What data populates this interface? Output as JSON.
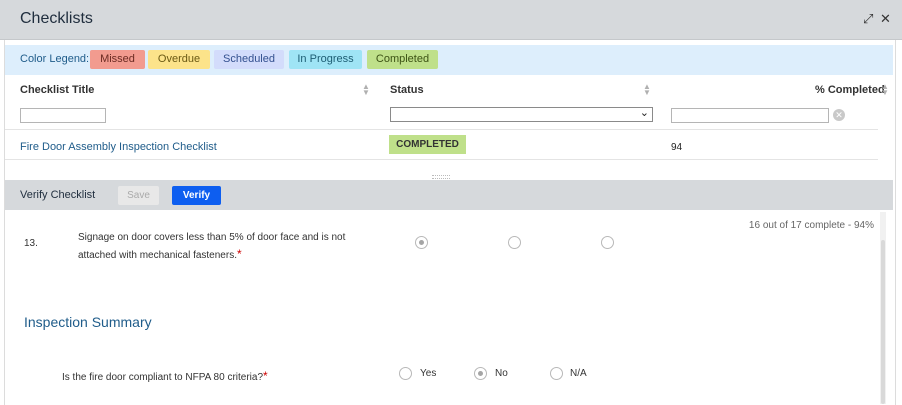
{
  "window": {
    "title": "Checklists",
    "expand_icon": "expand-icon",
    "close_icon": "close-icon"
  },
  "legend": {
    "label": "Color Legend:",
    "items": [
      {
        "label": "Missed",
        "bg": "#f29b8f",
        "fg": "#6b2a22"
      },
      {
        "label": "Overdue",
        "bg": "#fce38a",
        "fg": "#6b5a14"
      },
      {
        "label": "Scheduled",
        "bg": "#d3dcfb",
        "fg": "#33508f"
      },
      {
        "label": "In Progress",
        "bg": "#9fe4f5",
        "fg": "#1d5d73"
      },
      {
        "label": "Completed",
        "bg": "#bfe08a",
        "fg": "#3c5214"
      }
    ]
  },
  "table": {
    "columns": [
      "Checklist Title",
      "Status",
      "% Completed"
    ],
    "rows": [
      {
        "title": "Fire Door Assembly Inspection Checklist",
        "status": "COMPLETED",
        "percent": "94"
      }
    ]
  },
  "verify": {
    "title": "Verify Checklist",
    "save_label": "Save",
    "verify_label": "Verify"
  },
  "checklist": {
    "progress": "16 out of 17 complete - 94%",
    "question": {
      "number": "13.",
      "text": "Signage on door covers less than 5% of door face and is not attached with mechanical fasteners.",
      "required_mark": "*",
      "selected_option": 0
    },
    "summary_title": "Inspection Summary",
    "summary_question": {
      "text": "Is the fire door compliant to NFPA 80 criteria?",
      "required_mark": "*",
      "options": [
        "Yes",
        "No",
        "N/A"
      ],
      "selected": "No"
    }
  }
}
